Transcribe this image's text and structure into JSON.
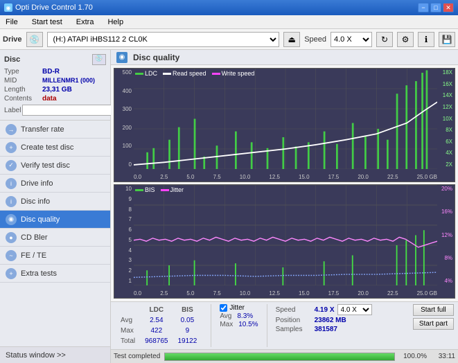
{
  "app": {
    "title": "Opti Drive Control 1.70",
    "minimize_label": "−",
    "maximize_label": "□",
    "close_label": "✕"
  },
  "menu": {
    "items": [
      "File",
      "Start test",
      "Extra",
      "Help"
    ]
  },
  "toolbar": {
    "drive_label": "Drive",
    "drive_value": "(H:) ATAPI iHBS112  2 CL0K",
    "speed_label": "Speed",
    "speed_value": "4.0 X"
  },
  "disc": {
    "section_title": "Disc",
    "type_label": "Type",
    "type_value": "BD-R",
    "mid_label": "MID",
    "mid_value": "MILLENMR1 (000)",
    "length_label": "Length",
    "length_value": "23,31 GB",
    "contents_label": "Contents",
    "contents_value": "data",
    "label_label": "Label"
  },
  "nav": {
    "items": [
      {
        "id": "transfer-rate",
        "label": "Transfer rate",
        "icon": "→"
      },
      {
        "id": "create-test-disc",
        "label": "Create test disc",
        "icon": "+"
      },
      {
        "id": "verify-test-disc",
        "label": "Verify test disc",
        "icon": "✓"
      },
      {
        "id": "drive-info",
        "label": "Drive info",
        "icon": "i"
      },
      {
        "id": "disc-info",
        "label": "Disc info",
        "icon": "i"
      },
      {
        "id": "disc-quality",
        "label": "Disc quality",
        "icon": "◉",
        "active": true
      },
      {
        "id": "cd-bler",
        "label": "CD Bler",
        "icon": "●"
      },
      {
        "id": "fe-te",
        "label": "FE / TE",
        "icon": "~"
      },
      {
        "id": "extra-tests",
        "label": "Extra tests",
        "icon": "+"
      }
    ]
  },
  "status_window": {
    "label": "Status window >> "
  },
  "disc_quality": {
    "title": "Disc quality",
    "legend": {
      "ldc_label": "LDC",
      "read_speed_label": "Read speed",
      "write_speed_label": "Write speed",
      "bis_label": "BIS",
      "jitter_label": "Jitter"
    }
  },
  "chart1": {
    "y_labels_left": [
      "500",
      "400",
      "300",
      "200",
      "100",
      "0"
    ],
    "y_labels_right": [
      "18X",
      "16X",
      "14X",
      "12X",
      "10X",
      "8X",
      "6X",
      "4X",
      "2X"
    ],
    "x_labels": [
      "0.0",
      "2.5",
      "5.0",
      "7.5",
      "10.0",
      "12.5",
      "15.0",
      "17.5",
      "20.0",
      "22.5",
      "25.0 GB"
    ]
  },
  "chart2": {
    "y_labels_left": [
      "10",
      "9",
      "8",
      "7",
      "6",
      "5",
      "4",
      "3",
      "2",
      "1"
    ],
    "y_labels_right": [
      "20%",
      "16%",
      "12%",
      "8%",
      "4%"
    ],
    "x_labels": [
      "0.0",
      "2.5",
      "5.0",
      "7.5",
      "10.0",
      "12.5",
      "15.0",
      "17.5",
      "20.0",
      "22.5",
      "25.0 GB"
    ]
  },
  "stats": {
    "col_ldc": "LDC",
    "col_bis": "BIS",
    "avg_label": "Avg",
    "avg_ldc": "2.54",
    "avg_bis": "0.05",
    "max_label": "Max",
    "max_ldc": "422",
    "max_bis": "9",
    "total_label": "Total",
    "total_ldc": "968765",
    "total_bis": "19122",
    "jitter_label": "Jitter",
    "jitter_avg": "8.3%",
    "jitter_max": "10.5%",
    "speed_label": "Speed",
    "speed_value": "4.19 X",
    "speed_select": "4.0 X",
    "position_label": "Position",
    "position_value": "23862 MB",
    "samples_label": "Samples",
    "samples_value": "381587"
  },
  "buttons": {
    "start_full": "Start full",
    "start_part": "Start part"
  },
  "progress": {
    "percent": "100.0%",
    "time": "33:11",
    "status": "Test completed"
  }
}
